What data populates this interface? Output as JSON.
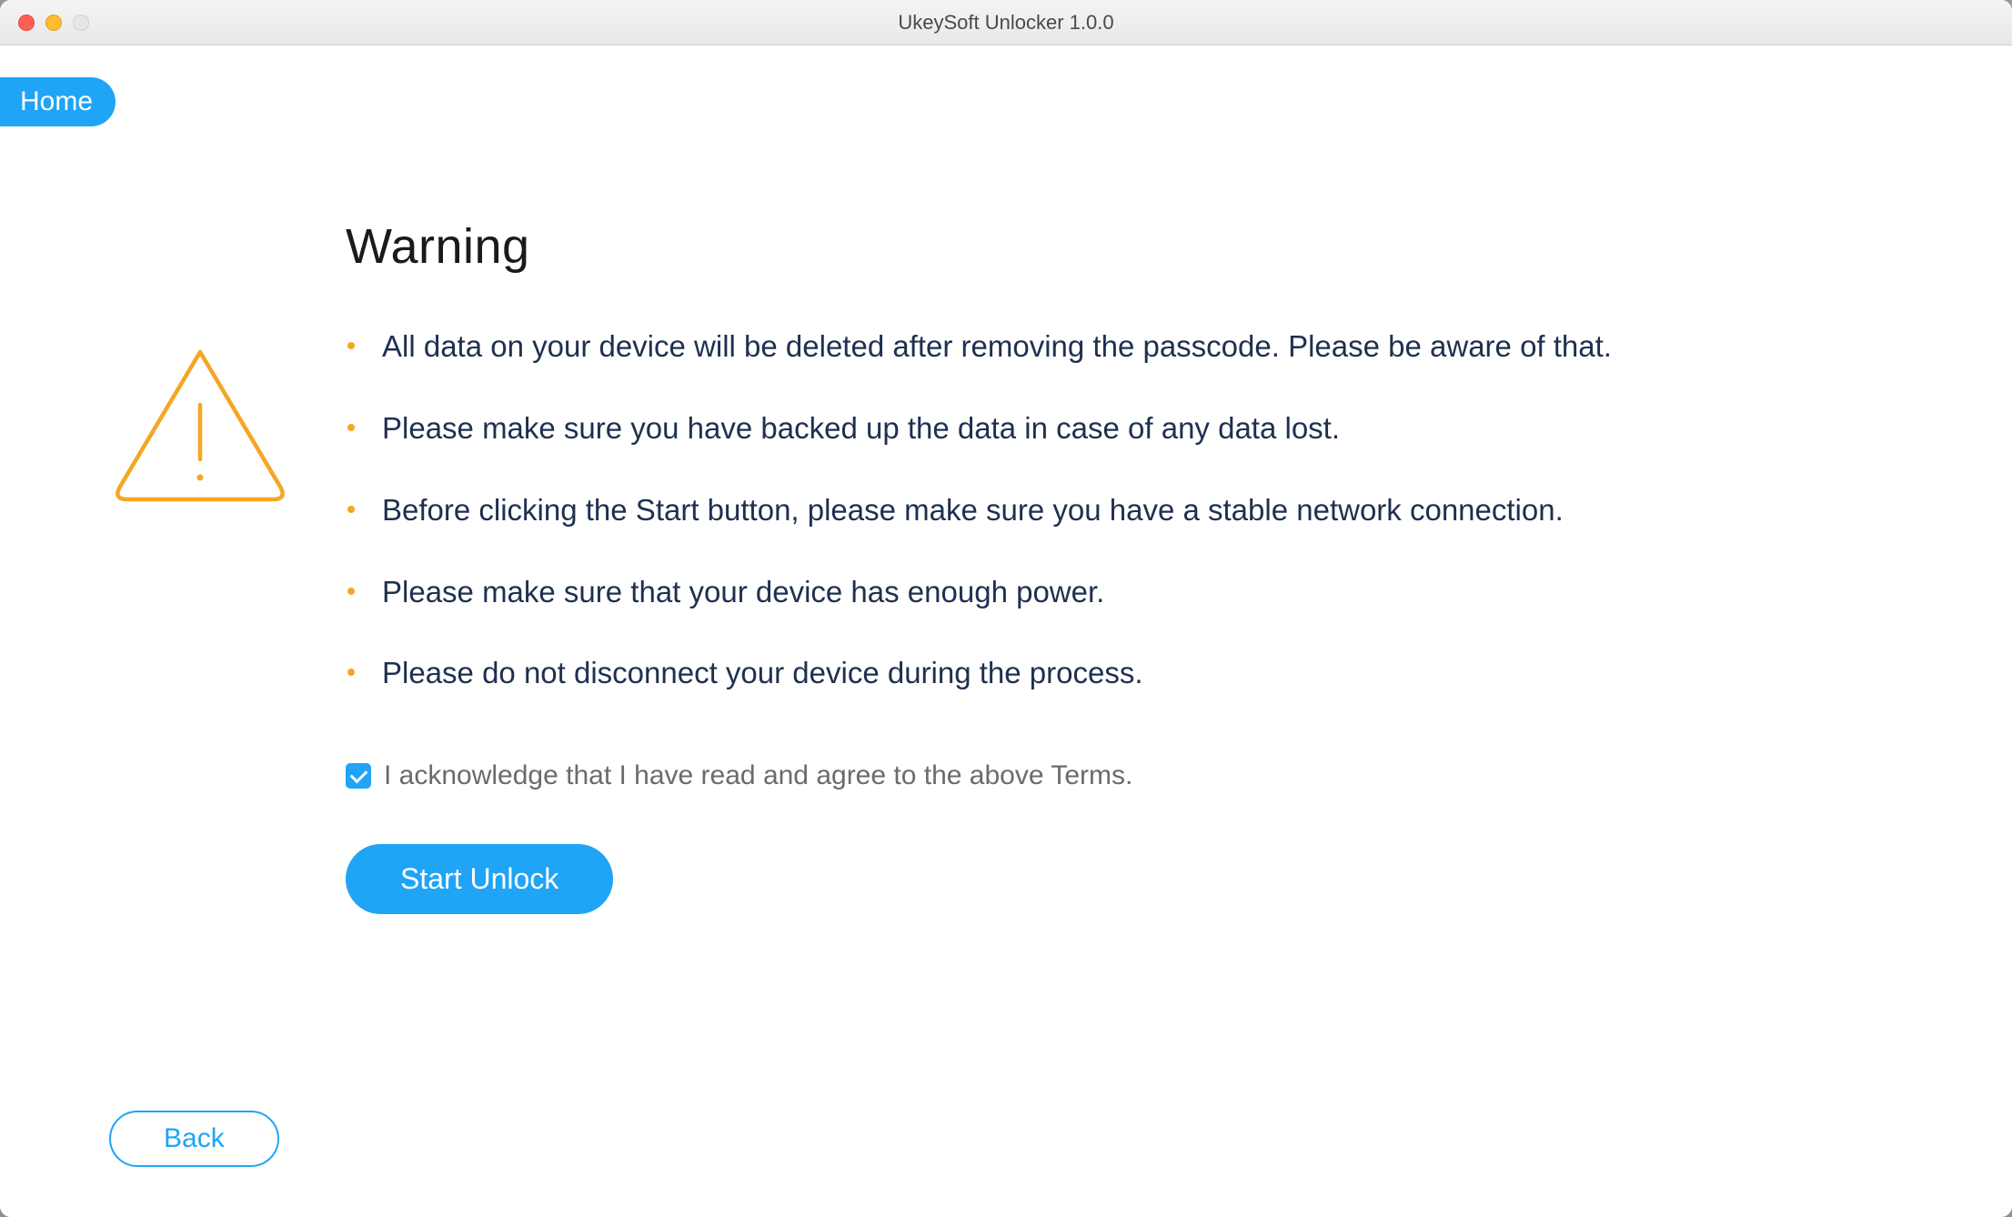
{
  "window": {
    "title": "UkeySoft Unlocker 1.0.0"
  },
  "nav": {
    "home_label": "Home"
  },
  "warning": {
    "heading": "Warning",
    "items": [
      "All data on your device will be deleted after removing the passcode. Please be aware of that.",
      "Please make sure you have backed up the data in case of any data lost.",
      "Before clicking the Start button, please make sure you have a stable network connection.",
      "Please make sure that your device has enough power.",
      "Please do not disconnect your device during the process."
    ]
  },
  "acknowledge": {
    "checked": true,
    "label": "I acknowledge that I have read and agree to the above Terms."
  },
  "buttons": {
    "start_label": "Start Unlock",
    "back_label": "Back"
  },
  "colors": {
    "accent": "#1fa4f6",
    "warning_icon": "#f5a623",
    "body_text": "#1e3050"
  }
}
